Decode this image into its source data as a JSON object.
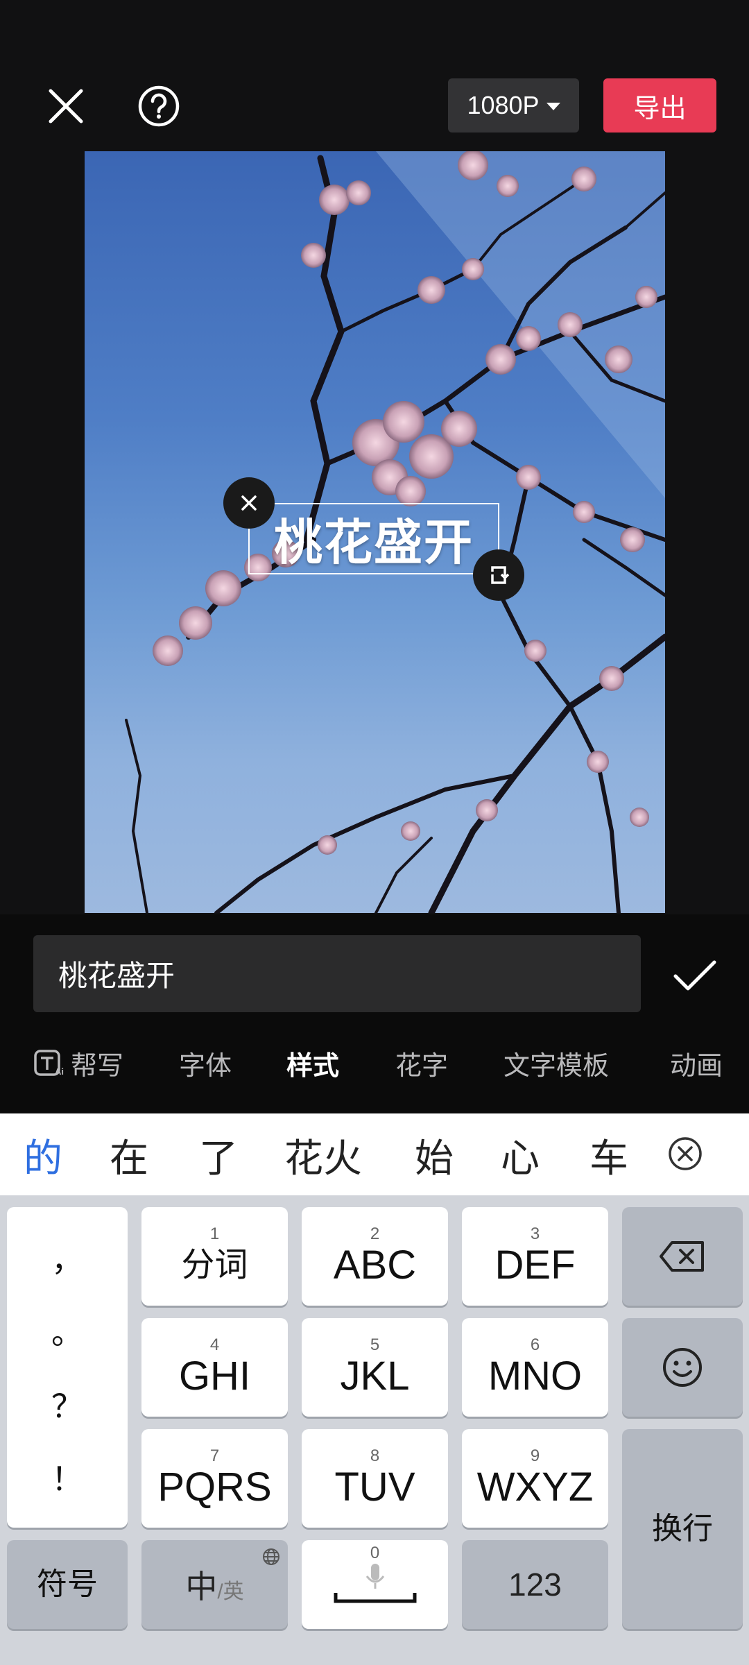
{
  "toolbar": {
    "resolution_label": "1080P",
    "export_label": "导出"
  },
  "overlay": {
    "text": "桃花盛开"
  },
  "editor": {
    "input_value": "桃花盛开"
  },
  "tabs": [
    {
      "label": "帮写"
    },
    {
      "label": "字体"
    },
    {
      "label": "样式",
      "active": true
    },
    {
      "label": "花字"
    },
    {
      "label": "文字模板"
    },
    {
      "label": "动画"
    }
  ],
  "candidates": [
    "的",
    "在",
    "了",
    "花火",
    "始",
    "心",
    "车"
  ],
  "keyboard": {
    "punctuation": [
      "，",
      "。",
      "？",
      "！"
    ],
    "keys": [
      {
        "num": "1",
        "label": "分词"
      },
      {
        "num": "2",
        "label": "ABC"
      },
      {
        "num": "3",
        "label": "DEF"
      },
      {
        "num": "4",
        "label": "GHI"
      },
      {
        "num": "5",
        "label": "JKL"
      },
      {
        "num": "6",
        "label": "MNO"
      },
      {
        "num": "7",
        "label": "PQRS"
      },
      {
        "num": "8",
        "label": "TUV"
      },
      {
        "num": "9",
        "label": "WXYZ"
      }
    ],
    "symbol_label": "符号",
    "lang_main": "中",
    "lang_sub": "/英",
    "space_num": "0",
    "numbers_label": "123",
    "enter_label": "换行"
  },
  "colors": {
    "accent_export": "#e83b55",
    "candidate_highlight": "#2f6fe0"
  }
}
